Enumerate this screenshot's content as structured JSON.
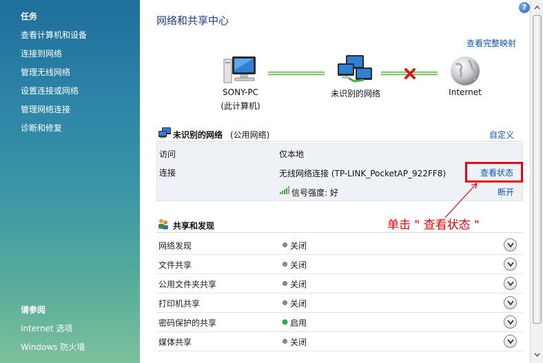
{
  "sidebar": {
    "tasks_title": "任务",
    "tasks": [
      "查看计算机和设备",
      "连接到网络",
      "管理无线网络",
      "设置连接或网络",
      "管理网络连接",
      "诊断和修复"
    ],
    "see_also_title": "请参阅",
    "see_also": [
      "Internet 选项",
      "Windows 防火墙"
    ]
  },
  "header": {
    "title": "网络和共享中心",
    "full_map": "查看完整映射"
  },
  "map": {
    "pc_name": "SONY-PC",
    "pc_sub": "(此计算机)",
    "network_label": "未识别的网络",
    "internet_label": "Internet"
  },
  "network": {
    "name": "未识别的网络",
    "type": "(公用网络)",
    "customize": "自定义",
    "access_label": "访问",
    "access_value": "仅本地",
    "connection_label": "连接",
    "connection_value": "无线网络连接 (TP-LINK_PocketAP_922FF8)",
    "view_status": "查看状态",
    "signal": "信号强度: 好",
    "disconnect": "断开"
  },
  "sharing": {
    "title": "共享和发现",
    "rows": [
      {
        "name": "网络发现",
        "value": "关闭",
        "on": false
      },
      {
        "name": "文件共享",
        "value": "关闭",
        "on": false
      },
      {
        "name": "公用文件夹共享",
        "value": "关闭",
        "on": false
      },
      {
        "name": "打印机共享",
        "value": "关闭",
        "on": false
      },
      {
        "name": "密码保护的共享",
        "value": "启用",
        "on": true
      },
      {
        "name": "媒体共享",
        "value": "关闭",
        "on": false
      }
    ]
  },
  "annotation": {
    "text": "单击 \" 查看状态 \"",
    "color": "#e8000b"
  },
  "colors": {
    "link": "#0b56b5",
    "title": "#1a3e8c"
  }
}
